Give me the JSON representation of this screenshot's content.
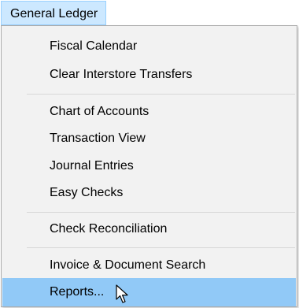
{
  "menubar": {
    "title": "General Ledger"
  },
  "menu": {
    "groups": [
      [
        "Fiscal Calendar",
        "Clear Interstore Transfers"
      ],
      [
        "Chart of Accounts",
        "Transaction View",
        "Journal Entries",
        "Easy Checks"
      ],
      [
        "Check Reconciliation"
      ],
      [
        "Invoice & Document Search",
        "Reports..."
      ]
    ],
    "highlighted_item": "Reports..."
  },
  "colors": {
    "menu_background": "#f2f2f2",
    "highlight": "#91c9f7",
    "menubar_highlight": "#cce8ff"
  },
  "icons": {
    "cursor": "mouse-pointer-icon"
  }
}
